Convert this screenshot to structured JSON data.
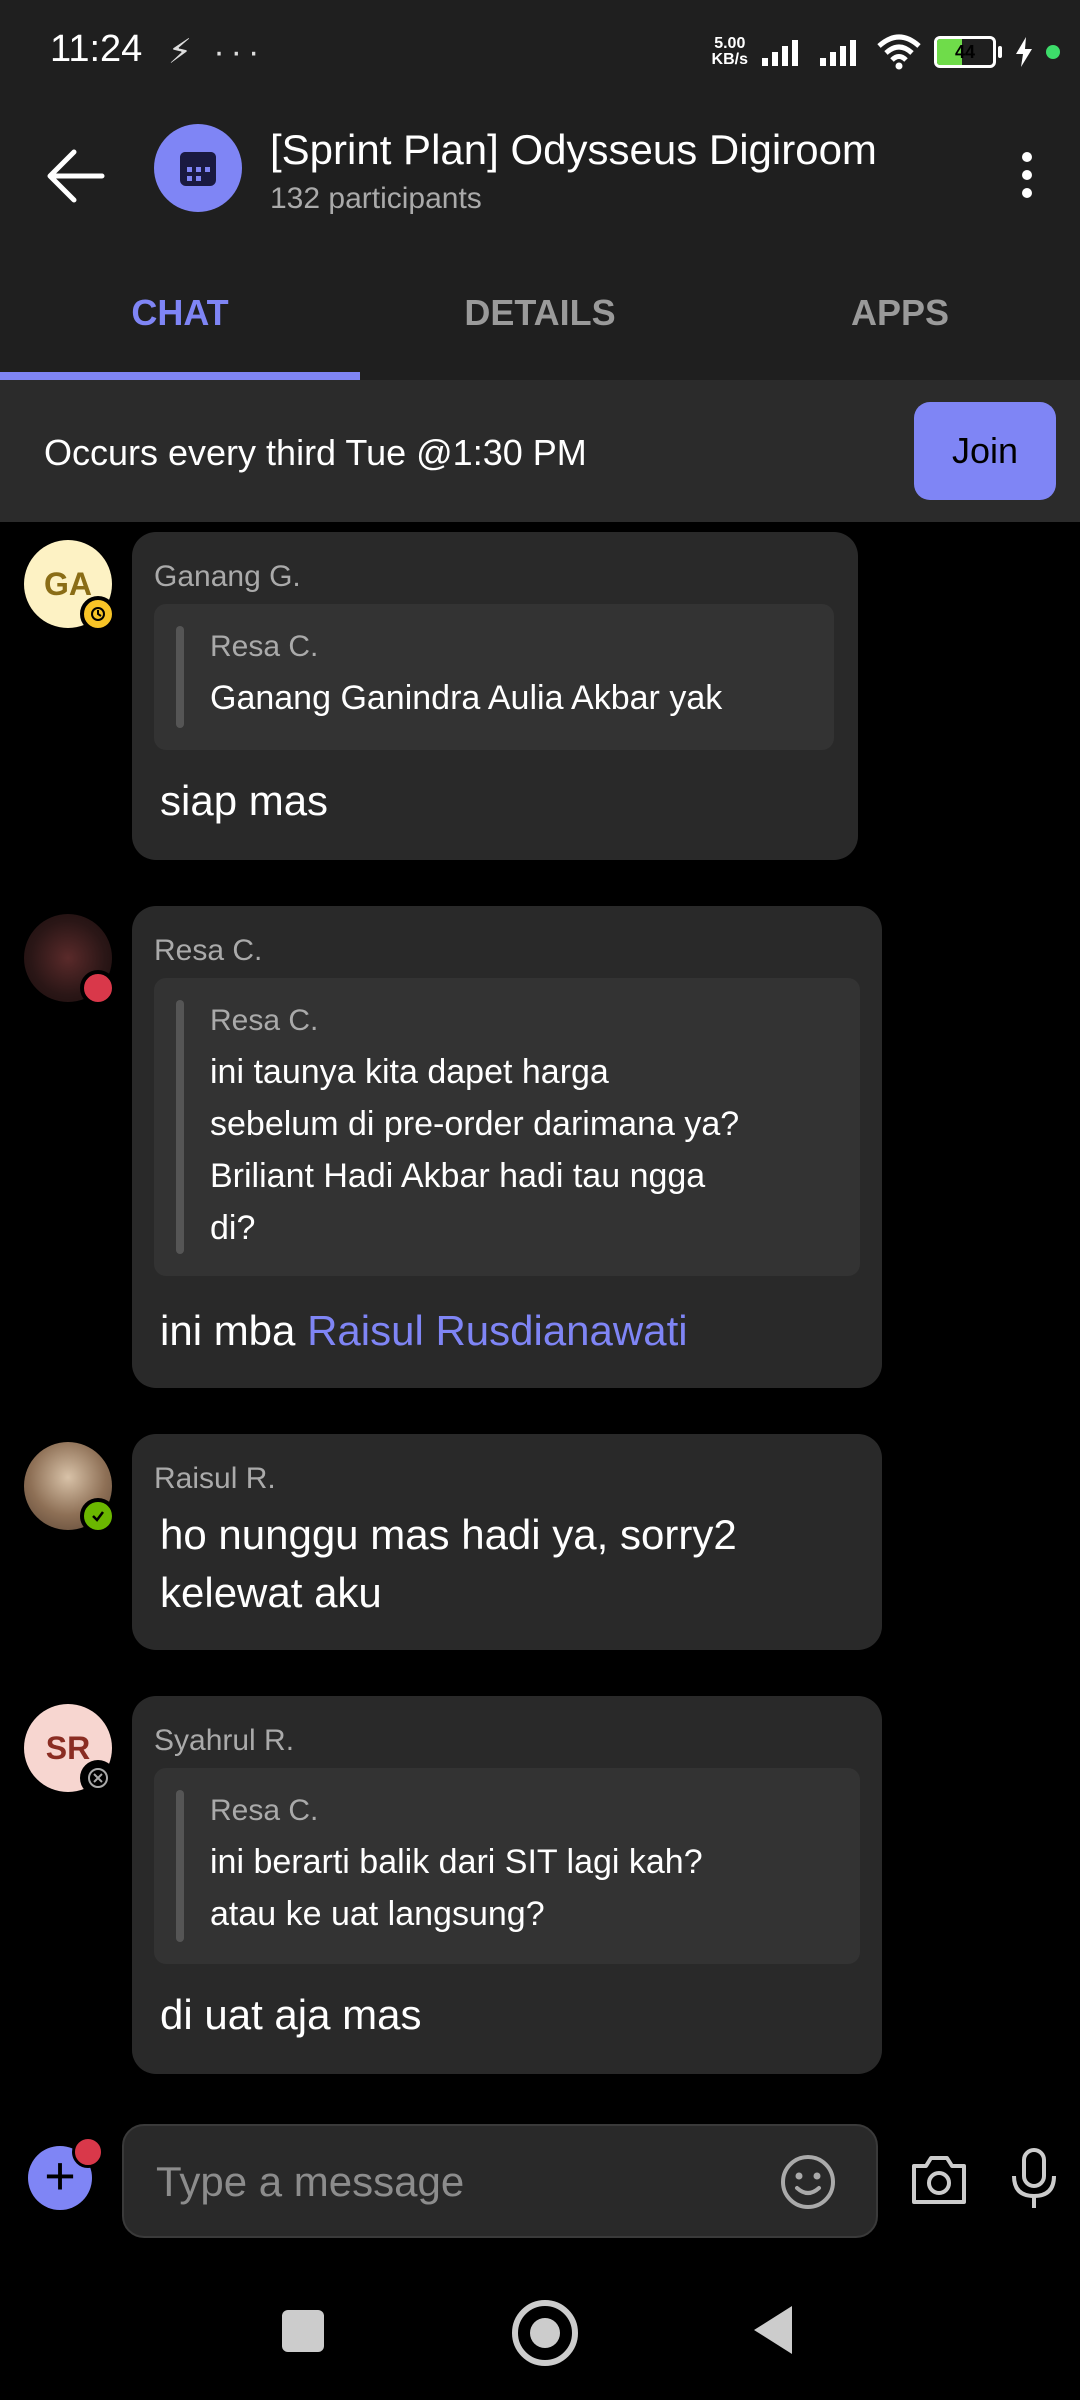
{
  "status_bar": {
    "time": "11:24",
    "left_icons": "⚡ ···",
    "net_speed_value": "5.00",
    "net_speed_unit": "KB/s",
    "battery": "44",
    "battery_level": 0.44
  },
  "header": {
    "title": "[Sprint Plan] Odysseus Digiroom",
    "subtitle": "132 participants"
  },
  "tabs": [
    {
      "label": "CHAT",
      "active": true
    },
    {
      "label": "DETAILS",
      "active": false
    },
    {
      "label": "APPS",
      "active": false
    }
  ],
  "banner": {
    "text": "Occurs every third Tue @1:30 PM",
    "join_label": "Join"
  },
  "messages": [
    {
      "initials": "GA",
      "sender": "Ganang G.",
      "quote_author": "Resa C.",
      "quote_text": "Ganang Ganindra Aulia Akbar yak",
      "body": "siap mas",
      "presence": "away"
    },
    {
      "initials": "",
      "sender": "Resa C.",
      "quote_author": "Resa C.",
      "quote_lines": [
        "ini taunya kita dapet harga",
        "sebelum di pre-order darimana ya?",
        "Briliant Hadi Akbar hadi tau ngga",
        "di?"
      ],
      "body_prefix": "ini mba ",
      "mention": "Raisul Rusdianawati",
      "presence": "busy"
    },
    {
      "initials": "",
      "sender": "Raisul R.",
      "body_lines": [
        "ho nunggu mas hadi ya, sorry2",
        "kelewat aku"
      ],
      "presence": "available"
    },
    {
      "initials": "SR",
      "sender": "Syahrul R.",
      "quote_author": "Resa C.",
      "quote_lines": [
        "ini berarti balik dari SIT lagi kah?",
        "atau ke uat langsung?"
      ],
      "body": "di uat aja mas",
      "presence": "offline"
    }
  ],
  "composer": {
    "placeholder": "Type a message"
  },
  "colors": {
    "accent": "#7f85f5",
    "away": "#f8c427",
    "busy": "#d9384a",
    "available": "#6bb700",
    "background": "#000000",
    "bubble": "#292929"
  }
}
